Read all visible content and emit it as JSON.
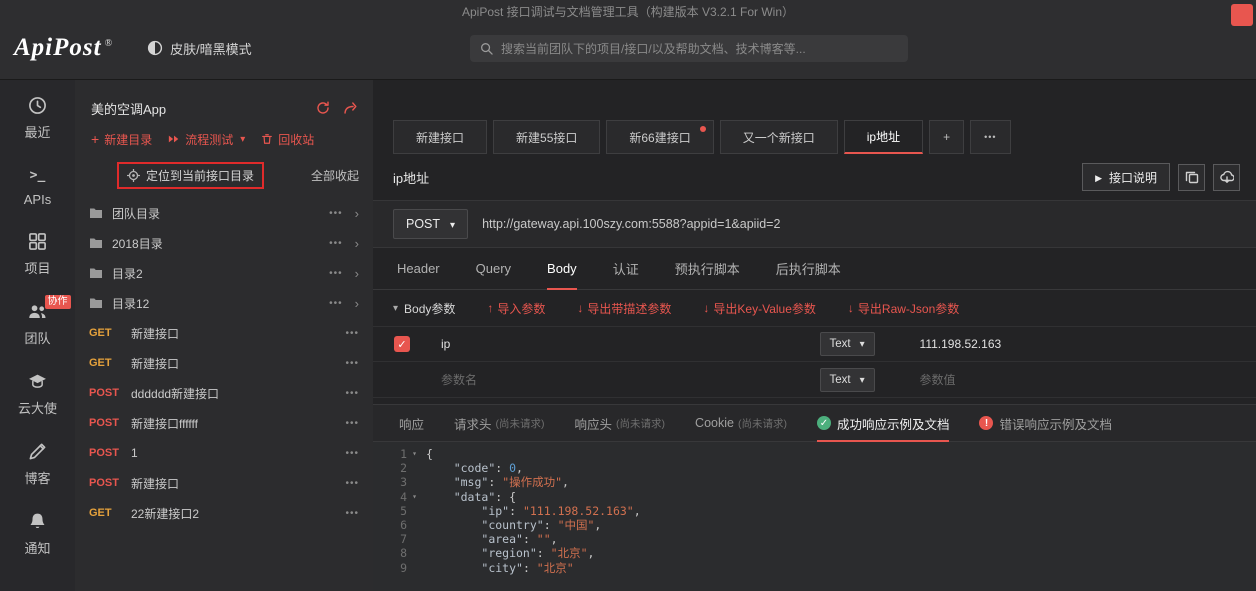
{
  "titlebar": {
    "app_title": "ApiPost 接口调试与文档管理工具（构建版本 V3.2.1 For Win）"
  },
  "header": {
    "logo": "ApiPost",
    "trademark": "®",
    "skin_toggle_label": "皮肤/暗黑模式",
    "search_placeholder": "搜索当前团队下的项目/接口/以及帮助文档、技术博客等..."
  },
  "nav": {
    "items": [
      {
        "label": "最近"
      },
      {
        "label": "APIs"
      },
      {
        "label": "项目"
      },
      {
        "label": "团队",
        "badge": "协作"
      },
      {
        "label": "云大使"
      },
      {
        "label": "博客"
      },
      {
        "label": "通知"
      }
    ]
  },
  "sidebar": {
    "project_name": "美的空调App",
    "new_dir_label": "新建目录",
    "flow_test_label": "流程测试",
    "recycle_label": "回收站",
    "locate_label": "定位到当前接口目录",
    "collapse_all_label": "全部收起",
    "folders": [
      {
        "label": "团队目录"
      },
      {
        "label": "2018目录"
      },
      {
        "label": "目录2"
      },
      {
        "label": "目录12"
      }
    ],
    "apis": [
      {
        "method": "GET",
        "cls": "get",
        "label": "新建接口"
      },
      {
        "method": "GET",
        "cls": "get",
        "label": "新建接口"
      },
      {
        "method": "POST",
        "cls": "post",
        "label": "dddddd新建接口"
      },
      {
        "method": "POST",
        "cls": "post",
        "label": "新建接口ffffff"
      },
      {
        "method": "POST",
        "cls": "post",
        "label": "1"
      },
      {
        "method": "POST",
        "cls": "post",
        "label": "新建接口"
      },
      {
        "method": "GET",
        "cls": "get",
        "label": "22新建接口2"
      }
    ]
  },
  "main": {
    "tabs": [
      {
        "label": "新建接口"
      },
      {
        "label": "新建55接口"
      },
      {
        "label": "新66建接口"
      },
      {
        "label": "又一个新接口"
      },
      {
        "label": "ip地址"
      }
    ],
    "new_tab_label": "+",
    "more_tabs_label": "•••",
    "api_title": "ip地址",
    "doc_button_label": "接口说明",
    "request": {
      "method": "POST",
      "url": "http://gateway.api.100szy.com:5588?appid=1&apiid=2"
    },
    "req_tabs": [
      {
        "label": "Header"
      },
      {
        "label": "Query"
      },
      {
        "label": "Body"
      },
      {
        "label": "认证"
      },
      {
        "label": "预执行脚本"
      },
      {
        "label": "后执行脚本"
      }
    ],
    "body_panel": {
      "section_label": "Body参数",
      "actions": [
        {
          "icon": "↑",
          "label": "导入参数"
        },
        {
          "icon": "↓",
          "label": "导出带描述参数"
        },
        {
          "icon": "↓",
          "label": "导出Key-Value参数"
        },
        {
          "icon": "↓",
          "label": "导出Raw-Json参数"
        }
      ],
      "rows": [
        {
          "name": "ip",
          "type": "Text",
          "value": "111.198.52.163"
        },
        {
          "name_placeholder": "参数名",
          "type": "Text",
          "value_placeholder": "参数值"
        }
      ]
    },
    "resp_tabs": [
      {
        "label": "响应"
      },
      {
        "label": "请求头",
        "hint": "(尚未请求)"
      },
      {
        "label": "响应头",
        "hint": "(尚未请求)"
      },
      {
        "label": "Cookie",
        "hint": "(尚未请求)"
      },
      {
        "label": "成功响应示例及文档"
      },
      {
        "label": "错误响应示例及文档"
      }
    ],
    "response_code": {
      "lines": [
        {
          "n": "1",
          "fold": "▾",
          "indent": "",
          "key": "",
          "sep": "",
          "val": "{",
          "cls": "punc",
          "post": ""
        },
        {
          "n": "2",
          "indent": "    ",
          "key": "\"code\"",
          "sep": ": ",
          "val": "0",
          "cls": "num",
          "post": ","
        },
        {
          "n": "3",
          "indent": "    ",
          "key": "\"msg\"",
          "sep": ": ",
          "val": "\"操作成功\"",
          "cls": "str",
          "post": ","
        },
        {
          "n": "4",
          "fold": "▾",
          "indent": "    ",
          "key": "\"data\"",
          "sep": ": ",
          "val": "{",
          "cls": "punc",
          "post": ""
        },
        {
          "n": "5",
          "indent": "        ",
          "key": "\"ip\"",
          "sep": ": ",
          "val": "\"111.198.52.163\"",
          "cls": "str",
          "post": ","
        },
        {
          "n": "6",
          "indent": "        ",
          "key": "\"country\"",
          "sep": ": ",
          "val": "\"中国\"",
          "cls": "str",
          "post": ","
        },
        {
          "n": "7",
          "indent": "        ",
          "key": "\"area\"",
          "sep": ": ",
          "val": "\"\"",
          "cls": "str",
          "post": ","
        },
        {
          "n": "8",
          "indent": "        ",
          "key": "\"region\"",
          "sep": ": ",
          "val": "\"北京\"",
          "cls": "str",
          "post": ","
        },
        {
          "n": "9",
          "indent": "        ",
          "key": "\"city\"",
          "sep": ": ",
          "val": "\"北京\"",
          "cls": "str",
          "post": ""
        }
      ]
    }
  },
  "colors": {
    "accent_red": "#e8564f",
    "annotation_red": "#e02b2b",
    "get_method": "#e6a23c",
    "post_method": "#e8564f",
    "success_green": "#4caf7d"
  }
}
